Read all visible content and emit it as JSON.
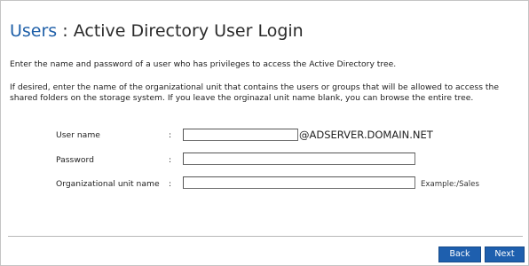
{
  "header": {
    "crumb": "Users",
    "separator": " : ",
    "title": "Active Directory User Login"
  },
  "intro_text": "Enter the name and password of a user who has privileges to access the Active Directory tree.",
  "description_text": "If desired, enter the name of the organizational unit that contains the users or groups that will be allowed to access the shared folders on the storage system. If you leave the orginazal unit name blank, you can browse the entire tree.",
  "form": {
    "separator": ":",
    "username": {
      "label": "User name",
      "value": "",
      "suffix": "@ADSERVER.DOMAIN.NET"
    },
    "password": {
      "label": "Password",
      "value": ""
    },
    "ou": {
      "label": "Organizational unit name",
      "value": "",
      "example": "Example:/Sales"
    }
  },
  "buttons": {
    "back": "Back",
    "next": "Next"
  },
  "colors": {
    "accent": "#1e5fa8",
    "button_bg": "#1e5fae"
  }
}
